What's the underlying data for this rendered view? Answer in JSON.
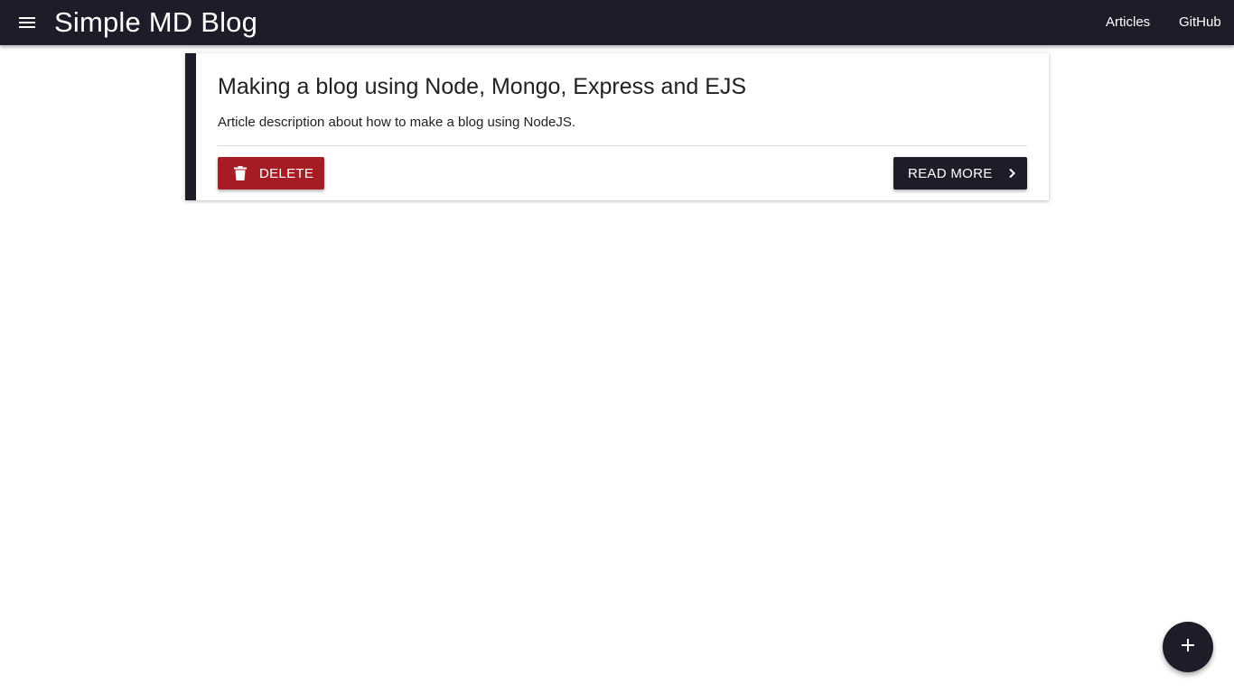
{
  "app": {
    "title": "Simple MD Blog"
  },
  "nav": {
    "menu_icon": "menu-icon",
    "links": [
      {
        "label": "Articles"
      },
      {
        "label": "GitHub"
      }
    ]
  },
  "articles": [
    {
      "title": "Making a blog using Node, Mongo, Express and EJS",
      "description": "Article description about how to make a blog using NodeJS.",
      "delete_label": "DELETE",
      "delete_icon": "trash-icon",
      "read_more_label": "READ MORE",
      "read_more_icon": "chevron-right-icon"
    }
  ],
  "fab": {
    "icon": "plus-icon",
    "action": "new-article"
  },
  "colors": {
    "primary": "#1d1c28",
    "danger": "#a61c24",
    "background": "#ffffff",
    "text": "#212121"
  }
}
